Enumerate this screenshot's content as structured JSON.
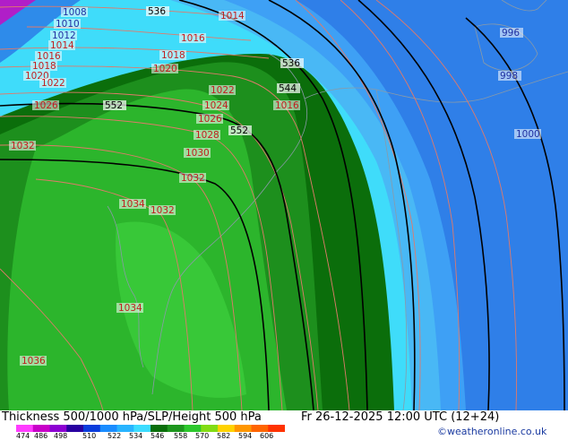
{
  "map": {
    "isobar_labels": [
      "1008",
      "1010",
      "1012",
      "1014",
      "1016",
      "1018",
      "1020",
      "1022",
      "1024",
      "1026",
      "1028",
      "1030",
      "1032",
      "1034",
      "1036",
      "1000",
      "996",
      "998"
    ],
    "height_labels": [
      "536",
      "544",
      "552"
    ],
    "thickness_fill_colors": [
      "#ff3cff",
      "#c800c8",
      "#8c00d2",
      "#2800a0",
      "#0a3cdc",
      "#1a8cff",
      "#28b4ff",
      "#3cdcff",
      "#0a6e0a",
      "#1e961e",
      "#2dc82d",
      "#82dc14",
      "#ffd200",
      "#ff9600",
      "#ff6400",
      "#ff3200"
    ]
  },
  "footer": {
    "title": "Thickness 500/1000 hPa/SLP/Height 500 hPa",
    "valid": "Fr 26-12-2025 12:00 UTC (12+24)",
    "credit": "©weatheronline.co.uk",
    "scale_ticks": [
      "474",
      "486",
      "498",
      "510",
      "522",
      "534",
      "546",
      "558",
      "570",
      "582",
      "594",
      "606"
    ]
  }
}
